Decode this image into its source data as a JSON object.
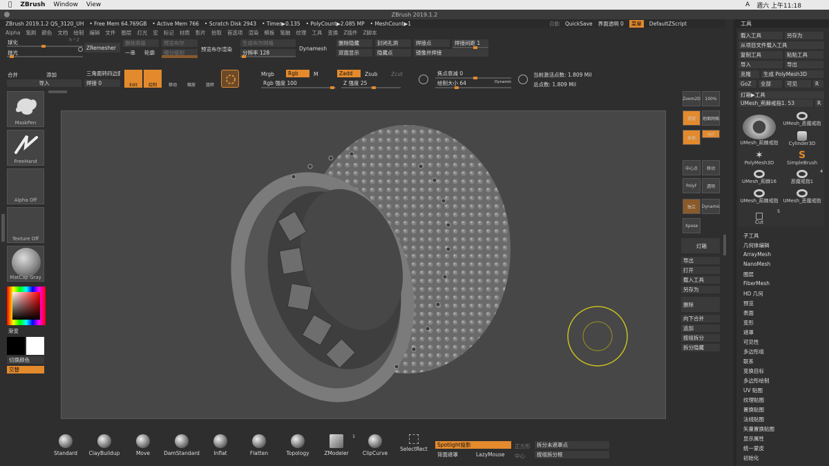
{
  "mac_menu": {
    "apple": "",
    "app": "ZBrush",
    "items": [
      "Window",
      "View"
    ],
    "clock": "週六 上午11:18",
    "input": "A"
  },
  "title": "ZBrush 2019.1.2",
  "info": {
    "version": "ZBrush 2019.1.2 QS_3120_UH",
    "free_mem": "• Free Mem 64.769GB",
    "active_mem": "• Active Mem 766",
    "scratch": "• Scratch Disk 2943",
    "timer": "• Timer▶0.135",
    "polycount": "• PolyCount▶2.085 MP",
    "meshcount": "• MeshCount▶1"
  },
  "topright": {
    "menu": "自動",
    "quicksave": "QuickSave",
    "transparency": "界面透明 0",
    "menus": "菜單",
    "script": "DefaultZScript"
  },
  "menubar": [
    "Alpha",
    "笔刷",
    "颜色",
    "文档",
    "绘制",
    "编辑",
    "文件",
    "图层",
    "灯光",
    "宏",
    "标记",
    "材质",
    "影片",
    "拾取",
    "首选项",
    "渲染",
    "模板",
    "笔触",
    "纹理",
    "工具",
    "变换",
    "Z插件",
    "Z脚本"
  ],
  "toolbar": {
    "r1": {
      "smooth": "球化",
      "rtz": "R ᴽ Z",
      "zremesher": "ZRemesher",
      "del_high": "删除高级",
      "preview_boolean": "预览布尔",
      "gen_boolean": "生成布尔网格",
      "del_hidden": "删除隐藏",
      "close_holes": "封闭孔洞",
      "weld": "焊接点",
      "weld_dist": "焊接间距 1"
    },
    "r2": {
      "polish": "抛光",
      "one": "一串",
      "ring": "轮廓",
      "subdiv": "细分级别",
      "boolean_render": "预览布尔渲染",
      "subdiv_rate": "分辨率 128",
      "dynamesh": "Dynamesh",
      "double": "双面显示",
      "hide_pts": "隐藏点",
      "mirror_weld": "镜像并焊接"
    },
    "r3": {
      "merge": "合并",
      "add": "添加",
      "import": "导入",
      "quad_tri": "三角面转四边面",
      "weld0": "焊接 0",
      "edit": "Edit",
      "draw": "绘制",
      "move": "移动",
      "scale": "缩放",
      "rotate": "旋转",
      "mrgb": "Mrgb",
      "rgb": "Rgb",
      "m": "M",
      "zadd": "Zadd",
      "zsub": "Zsub",
      "zcut": "Zcut",
      "focal": "焦点衰减 0",
      "draw_size": "绘制大小 64",
      "dynamic": "Dynamic",
      "rgb_int": "Rgb 强度 100",
      "z_int": "Z 强度 25",
      "active_pts": "当前激活点数: 1.809 Mil",
      "total_pts": "总点数: 1.809 Mil"
    }
  },
  "left": {
    "maskpen": "MaskPen",
    "freehand": "FreeHand",
    "alpha": "Alpha Off",
    "texture": "Texture Off",
    "matcap": "MatCap Gray",
    "gradient": "渐变",
    "switch_color": "切换颜色",
    "alternate": "交替"
  },
  "rightcol": {
    "zoom2d": "Zoom2D",
    "pct": "100%",
    "dynamic": "Dynamic",
    "persp": "透视",
    "floor": "地面网格",
    "local": "本地",
    "xyz": "xyz",
    "frame": "中心点",
    "move": "移动",
    "line_fill": "Line Fill",
    "polyf": "PolyF",
    "transp": "透明",
    "solo": "独立",
    "xpose": "Xpose"
  },
  "subpanel": {
    "light_box": "灯箱",
    "export": "导出",
    "open": "打开",
    "load_tool": "载入工具",
    "save_as": "另存为",
    "delete": "删除",
    "merge_down": "向下合并",
    "append": "追加",
    "clip_split": "按组拆分",
    "split_hidden": "拆分隐藏"
  },
  "toolpanel": {
    "header": "工具",
    "load": "载入工具",
    "saveas": "另存为",
    "load_project": "从项目文件载入工具",
    "copy": "复制工具",
    "paste": "粘贴工具",
    "import": "导入",
    "export": "导出",
    "clone": "克隆",
    "make_poly": "生成 PolyMesh3D",
    "goz": "GoZ",
    "all": "全部",
    "visible": "可见",
    "r": "R",
    "lightbox": "灯箱▶工具",
    "current": "UMesh_荊棘戒指1. 53",
    "r2": "R",
    "thumbs": [
      "UMesh_荊棘戒指",
      "UMesh_恶魔戒指",
      "Cylinder3D",
      "PolyMesh3D",
      "SimpleBrush",
      "UMesh_荊棘16",
      "恶魔戒指1",
      "UMesh_荊棘戒指",
      "UMesh_恶魔戒指",
      "Cut"
    ],
    "counts": [
      "4",
      "5"
    ],
    "menu": [
      "子工具",
      "几何体编辑",
      "ArrayMesh",
      "NanoMesh",
      "图层",
      "FiberMesh",
      "HD 几何",
      "预览",
      "表面",
      "变形",
      "遮罩",
      "可见性",
      "多边形组",
      "联系",
      "变换目标",
      "多边形绘制",
      "UV 贴图",
      "纹理贴图",
      "置换贴图",
      "法线贴图",
      "矢量置换贴图",
      "显示属性",
      "统一蒙皮",
      "初始化"
    ]
  },
  "bottom": {
    "brushes": [
      "Standard",
      "ClayBuildup",
      "Move",
      "DamStandard",
      "Inflat",
      "Flatten",
      "Topology",
      "ZModeler",
      "ClipCurve",
      "SelectRect"
    ],
    "zmodeler_count": "1",
    "spotlight": "Spotlight投影",
    "backface": "背面遮罩",
    "lazymouse": "LazyMouse",
    "front": "正方形",
    "center": "中心",
    "unmasked": "拆分未遮罩点",
    "groups_split": "按组拆分框"
  },
  "colors": {
    "accent": "#e38a2d",
    "brush_ring": "#c8c020"
  }
}
